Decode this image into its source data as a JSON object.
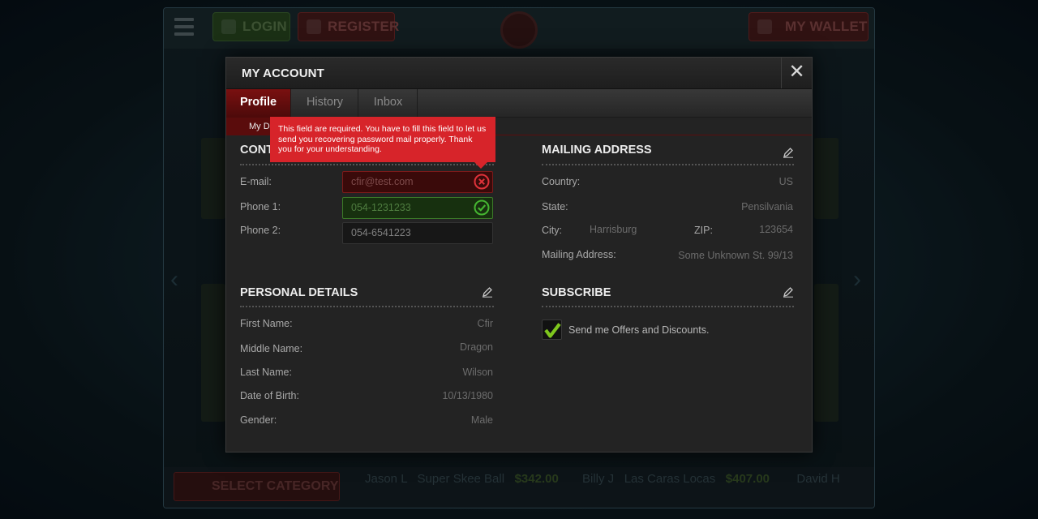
{
  "background": {
    "login_label": "LOGIN",
    "register_label": "REGISTER",
    "wallet_label": "MY WALLET",
    "select_category_label": "SELECT CATEGORY",
    "ticker": [
      {
        "player": "Jason L",
        "game": "Super Skee Ball",
        "amount": "$342.00"
      },
      {
        "player": "Billy J",
        "game": "Las Caras Locas",
        "amount": "$407.00"
      },
      {
        "player": "David H",
        "game": "",
        "amount": ""
      }
    ]
  },
  "modal": {
    "title": "MY ACCOUNT",
    "close_glyph": "✕",
    "tabs": [
      {
        "label": "Profile",
        "active": true
      },
      {
        "label": "History",
        "active": false
      },
      {
        "label": "Inbox",
        "active": false
      }
    ],
    "subtab_label": "My D",
    "tooltip": "This field are required. You have to fill this field to let us send you recovering password mail properly. Thank you for your understanding."
  },
  "contact": {
    "title": "CONT",
    "email_label": "E-mail:",
    "email_value": "cfir@test.com",
    "phone1_label": "Phone 1:",
    "phone1_value": "054-1231233",
    "phone2_label": "Phone 2:",
    "phone2_value": "054-6541223"
  },
  "mailing": {
    "title": "MAILING ADDRESS",
    "country_label": "Country:",
    "country_value": "US",
    "state_label": "State:",
    "state_value": "Pensilvania",
    "city_label": "City:",
    "city_value": "Harrisburg",
    "zip_label": "ZIP:",
    "zip_value": "123654",
    "address_label": "Mailing Address:",
    "address_value": "Some Unknown St. 99/13"
  },
  "personal": {
    "title": "PERSONAL DETAILS",
    "first_label": "First Name:",
    "first_value": "Cfir",
    "middle_label": "Middle Name:",
    "middle_value": "Dragon",
    "last_label": "Last Name:",
    "last_value": "Wilson",
    "dob_label": "Date of Birth:",
    "dob_value": "10/13/1980",
    "gender_label": "Gender:",
    "gender_value": "Male"
  },
  "subscribe": {
    "title": "SUBSCRIBE",
    "offers_label": "Send me Offers and Discounts.",
    "offers_checked": true
  },
  "colors": {
    "accent_red": "#d7242a",
    "success_green": "#3c7a28",
    "check_green": "#7ec61d"
  }
}
